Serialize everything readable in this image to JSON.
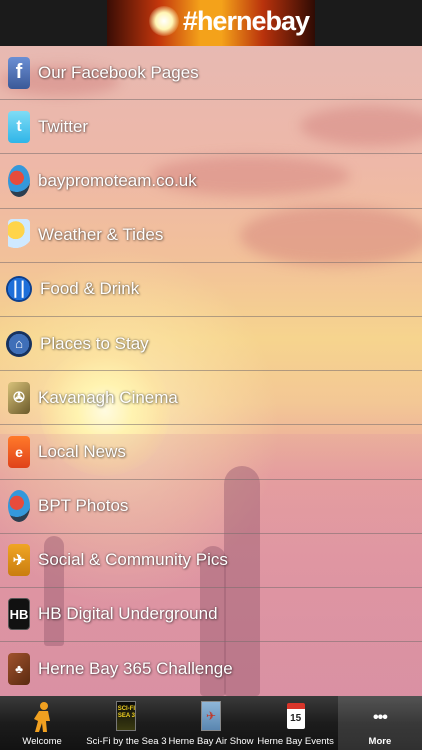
{
  "header": {
    "banner_text": "#hernebay"
  },
  "menu": {
    "items": [
      {
        "label": "Our Facebook Pages",
        "icon": "facebook-icon"
      },
      {
        "label": "Twitter",
        "icon": "twitter-icon"
      },
      {
        "label": "baypromoteam.co.uk",
        "icon": "bpt-logo-icon"
      },
      {
        "label": "Weather & Tides",
        "icon": "weather-icon"
      },
      {
        "label": "Food & Drink",
        "icon": "cutlery-icon"
      },
      {
        "label": "Places to Stay",
        "icon": "home-icon"
      },
      {
        "label": "Kavanagh Cinema",
        "icon": "film-projector-icon"
      },
      {
        "label": "Local News",
        "icon": "news-icon"
      },
      {
        "label": "BPT Photos",
        "icon": "bpt-photos-icon"
      },
      {
        "label": "Social & Community Pics",
        "icon": "bird-icon"
      },
      {
        "label": "HB Digital Underground",
        "icon": "hb-icon"
      },
      {
        "label": "Herne Bay 365 Challenge",
        "icon": "challenge-icon"
      }
    ],
    "hb_icon_text": "HB"
  },
  "tabs": [
    {
      "label": "Welcome",
      "icon": "person-icon"
    },
    {
      "label": "Sci-Fi by the Sea 3",
      "icon": "scifi-poster-icon",
      "icon_text": "SCI-FI SEA 3"
    },
    {
      "label": "Herne Bay Air Show",
      "icon": "airshow-icon"
    },
    {
      "label": "Herne Bay Events",
      "icon": "calendar-icon",
      "icon_text": "15"
    },
    {
      "label": "More",
      "icon": "more-dots-icon",
      "icon_text": "•••"
    }
  ]
}
